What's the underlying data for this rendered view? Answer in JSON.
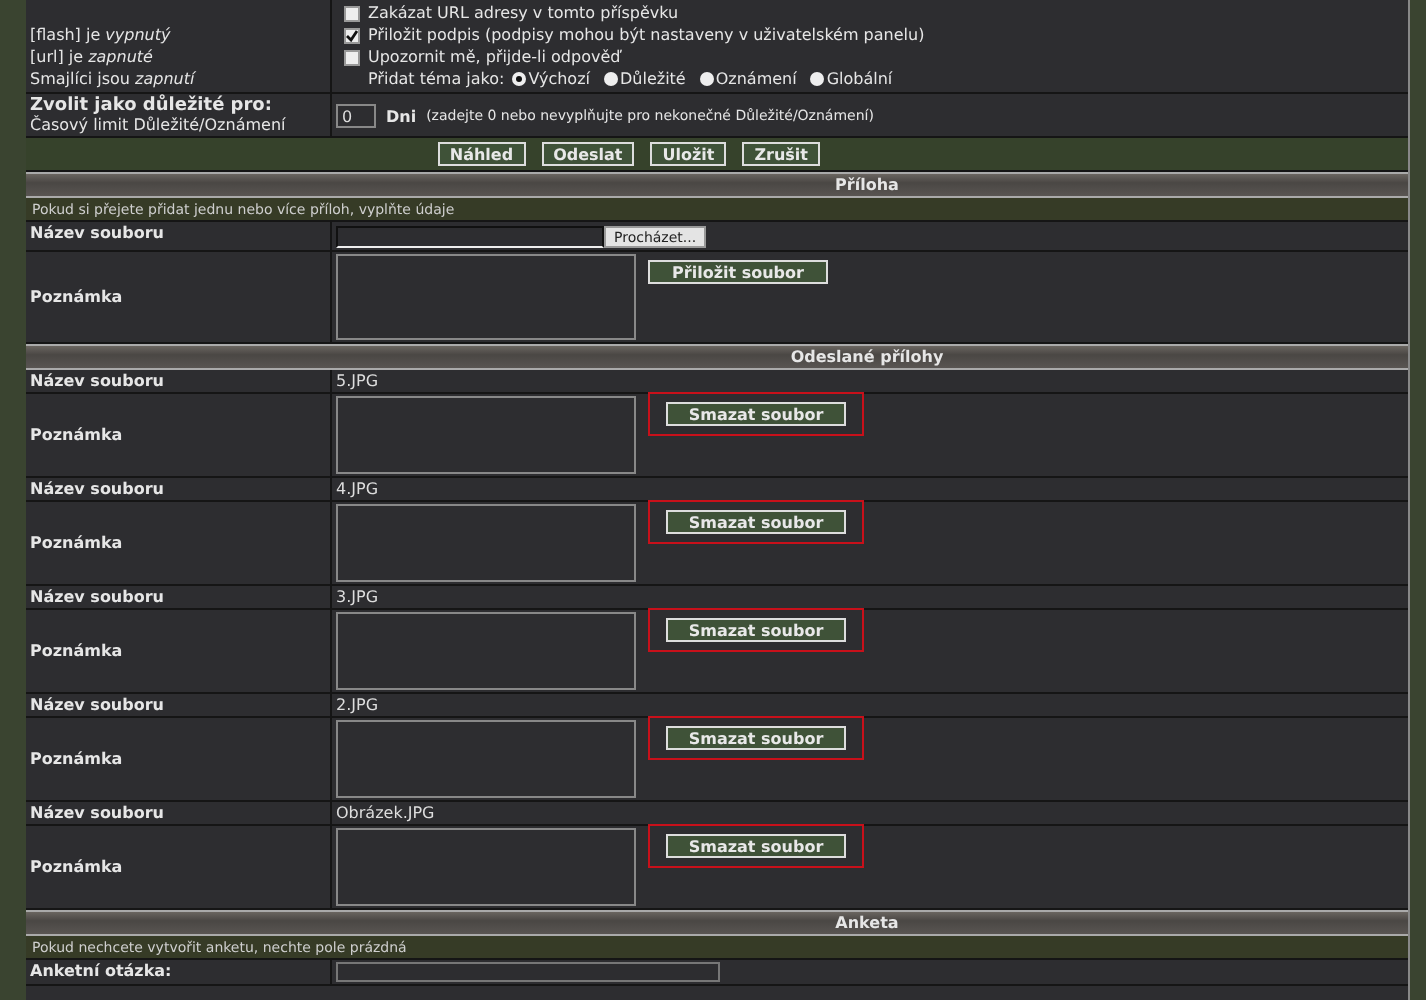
{
  "options": {
    "status_lines": [
      "[flash] je *vypnutý*",
      "[url] je *zapnuté*",
      "Smajlíci jsou *zapnutí*"
    ],
    "checkboxes": [
      {
        "label": "Zakázat URL adresy v tomto příspěvku",
        "checked": false
      },
      {
        "label": "Přiložit podpis (podpisy mohou být nastaveny v uživatelském panelu)",
        "checked": true
      },
      {
        "label": "Upozornit mě, přijde-li odpověď",
        "checked": false
      }
    ],
    "topic_type": {
      "label": "Přidat téma jako:",
      "choices": [
        {
          "label": "Výchozí",
          "selected": true
        },
        {
          "label": "Důležité",
          "selected": false
        },
        {
          "label": "Oznámení",
          "selected": false
        },
        {
          "label": "Globální",
          "selected": false
        }
      ]
    }
  },
  "sticky": {
    "label": "Zvolit jako důležité pro:",
    "sublabel": "Časový limit Důležité/Oznámení",
    "value": "0",
    "unit": "Dni",
    "hint": "(zadejte 0 nebo nevyplňujte pro nekonečné Důležité/Oznámení)"
  },
  "actions": [
    "Náhled",
    "Odeslat",
    "Uložit",
    "Zrušit"
  ],
  "attach": {
    "title": "Příloha",
    "hint": "Pokud si přejete přidat jednu nebo více příloh, vyplňte údaje",
    "file_label": "Název souboru",
    "browse": "Procházet...",
    "note_label": "Poznámka",
    "add_button": "Přiložit soubor"
  },
  "posted": {
    "title": "Odeslané přílohy",
    "items": [
      {
        "file_label": "Název souboru",
        "file": "5.JPG",
        "note_label": "Poznámka",
        "button": "Smazat soubor",
        "highlighted": true
      },
      {
        "file_label": "Název souboru",
        "file": "4.JPG",
        "note_label": "Poznámka",
        "button": "Smazat soubor",
        "highlighted": true
      },
      {
        "file_label": "Název souboru",
        "file": "3.JPG",
        "note_label": "Poznámka",
        "button": "Smazat soubor",
        "highlighted": true
      },
      {
        "file_label": "Název souboru",
        "file": "2.JPG",
        "note_label": "Poznámka",
        "button": "Smazat soubor",
        "highlighted": true
      },
      {
        "file_label": "Název souboru",
        "file": "Obrázek.JPG",
        "note_label": "Poznámka",
        "button": "Smazat soubor",
        "highlighted": true
      }
    ]
  },
  "poll": {
    "title": "Anketa",
    "hint": "Pokud nechcete vytvořit anketu, nechte pole prázdná",
    "question_label": "Anketní otázka:"
  }
}
